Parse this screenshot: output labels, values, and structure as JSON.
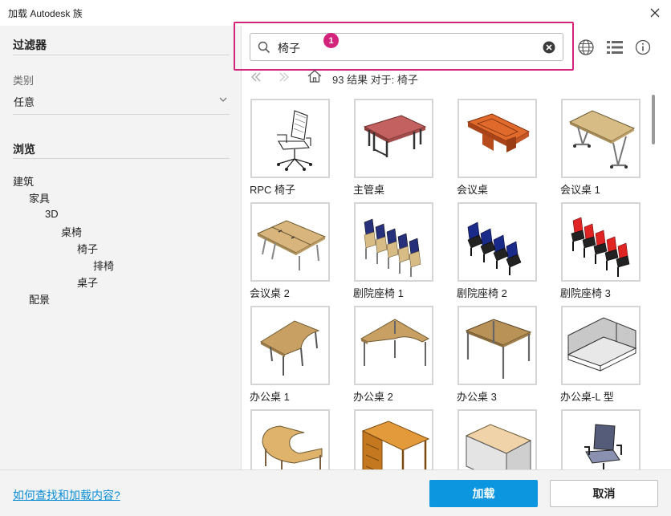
{
  "window": {
    "title": "加载 Autodesk 族"
  },
  "filter": {
    "title": "过滤器",
    "category_label": "类别",
    "category_value": "任意"
  },
  "browse": {
    "title": "浏览",
    "tree": [
      "建筑",
      "家具",
      "3D",
      "桌椅",
      "椅子",
      "排椅",
      "桌子",
      "配景"
    ]
  },
  "search": {
    "value": "椅子",
    "placeholder": ""
  },
  "callout": {
    "number": "1"
  },
  "results": {
    "text": "93 结果 对于: 椅子"
  },
  "items": [
    {
      "name": "RPC 椅子",
      "icon": "office-chair"
    },
    {
      "name": "主管桌",
      "icon": "executive-desk"
    },
    {
      "name": "会议桌",
      "icon": "conference-table"
    },
    {
      "name": "会议桌 1",
      "icon": "folding-table"
    },
    {
      "name": "会议桌 2",
      "icon": "split-conference-table"
    },
    {
      "name": "剧院座椅 1",
      "icon": "theater-seats-blue"
    },
    {
      "name": "剧院座椅 2",
      "icon": "theater-seats-navy"
    },
    {
      "name": "剧院座椅 3",
      "icon": "theater-seats-red"
    },
    {
      "name": "办公桌 1",
      "icon": "corner-desk"
    },
    {
      "name": "办公桌 2",
      "icon": "l-desk"
    },
    {
      "name": "办公桌 3",
      "icon": "square-desk"
    },
    {
      "name": "办公桌-L 型",
      "icon": "l-cubicle"
    },
    {
      "name": "",
      "icon": "reception-desk"
    },
    {
      "name": "",
      "icon": "drawer-desk"
    },
    {
      "name": "",
      "icon": "white-desk"
    },
    {
      "name": "",
      "icon": "task-chair"
    }
  ],
  "footer": {
    "help": "如何查找和加载内容?",
    "load": "加载",
    "cancel": "取消"
  },
  "colors": {
    "accent": "#0b96df",
    "callout": "#d3247c",
    "link": "#0a8ed6"
  }
}
